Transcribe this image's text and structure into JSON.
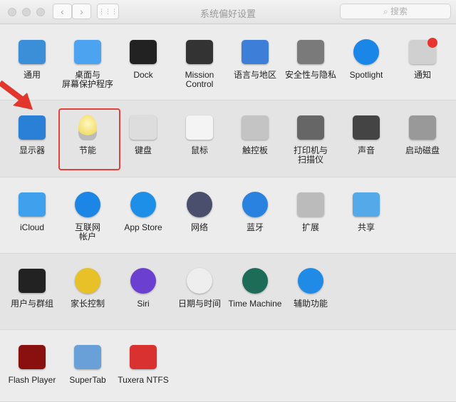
{
  "window": {
    "title": "系统偏好设置",
    "back": "‹",
    "forward": "›",
    "grid": "⋮⋮⋮",
    "search_placeholder": "搜索",
    "search_icon": "magnifier-icon"
  },
  "rows": [
    [
      {
        "label": "通用",
        "icon": "general-icon",
        "color": "#3b8fd9"
      },
      {
        "label": "桌面与\n屏幕保护程序",
        "icon": "desktop-icon",
        "color": "#4ca3f0"
      },
      {
        "label": "Dock",
        "icon": "dock-icon",
        "color": "#222"
      },
      {
        "label": "Mission\nControl",
        "icon": "mission-control-icon",
        "color": "#333"
      },
      {
        "label": "语言与地区",
        "icon": "flag-icon",
        "color": "#3d7ed8"
      },
      {
        "label": "安全性与隐私",
        "icon": "house-lock-icon",
        "color": "#7a7a7a"
      },
      {
        "label": "Spotlight",
        "icon": "spotlight-icon",
        "color": "#1a86e8"
      },
      {
        "label": "通知",
        "icon": "notifications-icon",
        "color": "#d0d0d0"
      }
    ],
    [
      {
        "label": "显示器",
        "icon": "display-icon",
        "color": "#2a7fd6"
      },
      {
        "label": "节能",
        "icon": "lightbulb-icon",
        "color": "#f5e27a"
      },
      {
        "label": "键盘",
        "icon": "keyboard-icon",
        "color": "#ddd"
      },
      {
        "label": "鼠标",
        "icon": "mouse-icon",
        "color": "#f4f4f4"
      },
      {
        "label": "触控板",
        "icon": "trackpad-icon",
        "color": "#c4c4c4"
      },
      {
        "label": "打印机与\n扫描仪",
        "icon": "printer-icon",
        "color": "#666"
      },
      {
        "label": "声音",
        "icon": "speaker-icon",
        "color": "#444"
      },
      {
        "label": "启动磁盘",
        "icon": "disk-icon",
        "color": "#999"
      }
    ],
    [
      {
        "label": "iCloud",
        "icon": "cloud-icon",
        "color": "#3fa0ee"
      },
      {
        "label": "互联网\n帐户",
        "icon": "at-icon",
        "color": "#1c86e6"
      },
      {
        "label": "App Store",
        "icon": "app-store-icon",
        "color": "#1d8fe8"
      },
      {
        "label": "网络",
        "icon": "globe-icon",
        "color": "#4a4f6e"
      },
      {
        "label": "蓝牙",
        "icon": "bluetooth-icon",
        "color": "#2a82e0"
      },
      {
        "label": "扩展",
        "icon": "puzzle-icon",
        "color": "#bbb"
      },
      {
        "label": "共享",
        "icon": "folder-icon",
        "color": "#54a9e8"
      }
    ],
    [
      {
        "label": "用户与群组",
        "icon": "users-icon",
        "color": "#222"
      },
      {
        "label": "家长控制",
        "icon": "parental-icon",
        "color": "#e8c128"
      },
      {
        "label": "Siri",
        "icon": "siri-icon",
        "color": "#6b3fd0"
      },
      {
        "label": "日期与时间",
        "icon": "clock-icon",
        "color": "#eee"
      },
      {
        "label": "Time Machine",
        "icon": "time-machine-icon",
        "color": "#1d6c58"
      },
      {
        "label": "辅助功能",
        "icon": "accessibility-icon",
        "color": "#1f8be6"
      }
    ],
    [
      {
        "label": "Flash Player",
        "icon": "flash-icon",
        "color": "#8a1010"
      },
      {
        "label": "SuperTab",
        "icon": "supertab-icon",
        "color": "#6aa0d8"
      },
      {
        "label": "Tuxera NTFS",
        "icon": "tuxera-icon",
        "color": "#d93030"
      }
    ]
  ],
  "highlight_color": "#e0413a"
}
